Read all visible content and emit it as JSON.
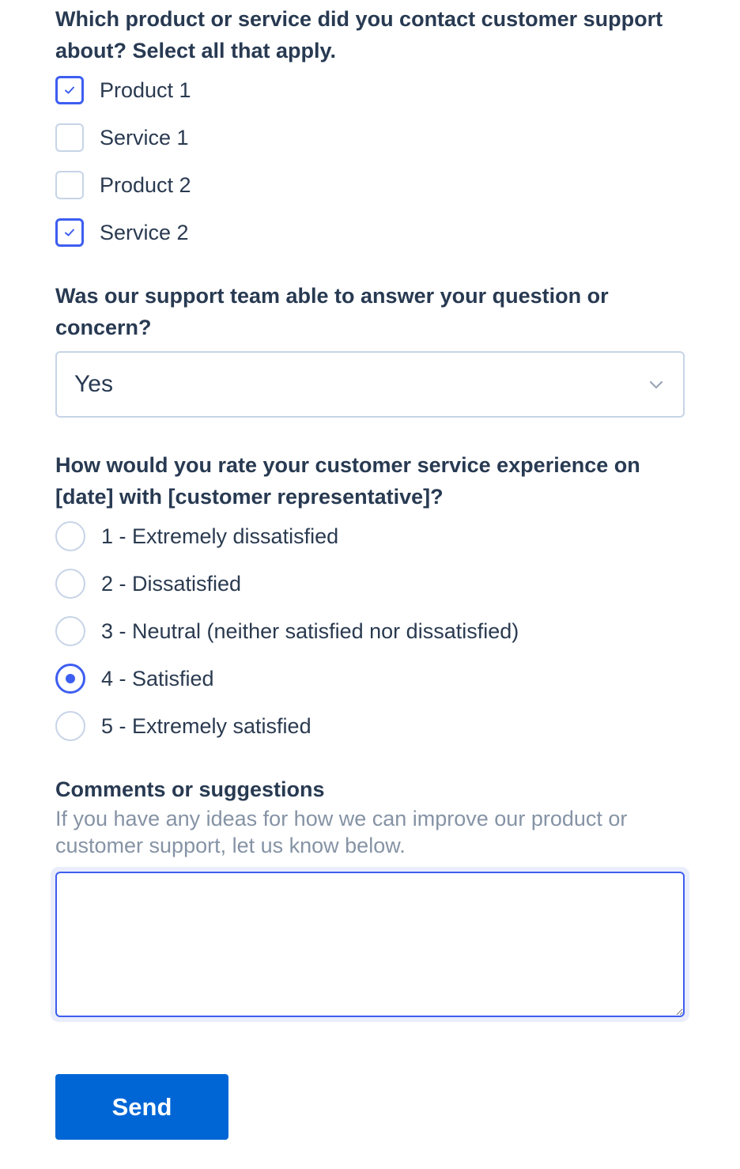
{
  "question1": {
    "label": "Which product or service did you contact customer support about? Select all that apply.",
    "options": [
      {
        "label": "Product 1",
        "checked": true
      },
      {
        "label": "Service 1",
        "checked": false
      },
      {
        "label": "Product 2",
        "checked": false
      },
      {
        "label": "Service 2",
        "checked": true
      }
    ]
  },
  "question2": {
    "label": "Was our support team able to answer your question or concern?",
    "selected": "Yes",
    "icon": "chevron-down-icon"
  },
  "question3": {
    "label": "How would you rate your customer service experience on [date] with [customer representative]?",
    "options": [
      {
        "label": "1 - Extremely dissatisfied",
        "checked": false
      },
      {
        "label": "2 - Dissatisfied",
        "checked": false
      },
      {
        "label": "3 - Neutral (neither satisfied nor dissatisfied)",
        "checked": false
      },
      {
        "label": "4 - Satisfied",
        "checked": true
      },
      {
        "label": "5 - Extremely satisfied",
        "checked": false
      }
    ]
  },
  "comments": {
    "label": "Comments or suggestions",
    "hint": "If you have any ideas for how we can improve our product or customer support, let us know below.",
    "value": "",
    "placeholder": ""
  },
  "submit": {
    "label": "Send"
  },
  "colors": {
    "accent": "#3d5ef0",
    "button": "#0066d6",
    "border": "#c7d4e7",
    "text": "#283a52",
    "hint": "#8593a5"
  }
}
